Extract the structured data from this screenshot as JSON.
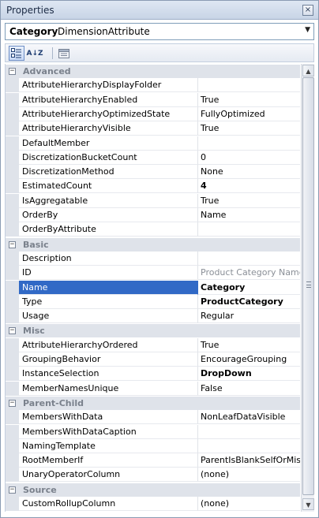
{
  "window": {
    "title": "Properties",
    "close_glyph": "×"
  },
  "object_selector": {
    "label": "Category",
    "value": "DimensionAttribute",
    "dropdown_glyph": "▼"
  },
  "toolbar": {
    "categorized_icon": "categorized-icon",
    "alphabetical_label": "A↓Z",
    "property_pages_icon": "property-pages-icon"
  },
  "grid": {
    "categories": [
      {
        "name": "Advanced",
        "toggle": "−",
        "properties": [
          {
            "name": "AttributeHierarchyDisplayFolder",
            "value": ""
          },
          {
            "name": "AttributeHierarchyEnabled",
            "value": "True"
          },
          {
            "name": "AttributeHierarchyOptimizedState",
            "value": "FullyOptimized"
          },
          {
            "name": "AttributeHierarchyVisible",
            "value": "True"
          },
          {
            "name": "DefaultMember",
            "value": ""
          },
          {
            "name": "DiscretizationBucketCount",
            "value": "0"
          },
          {
            "name": "DiscretizationMethod",
            "value": "None"
          },
          {
            "name": "EstimatedCount",
            "value": "4",
            "bold": true
          },
          {
            "name": "IsAggregatable",
            "value": "True"
          },
          {
            "name": "OrderBy",
            "value": "Name"
          },
          {
            "name": "OrderByAttribute",
            "value": ""
          }
        ]
      },
      {
        "name": "Basic",
        "toggle": "−",
        "properties": [
          {
            "name": "Description",
            "value": ""
          },
          {
            "name": "ID",
            "value": "Product Category Name",
            "dim": true
          },
          {
            "name": "Name",
            "value": "Category",
            "bold": true,
            "selected": true
          },
          {
            "name": "Type",
            "value": "ProductCategory",
            "bold": true
          },
          {
            "name": "Usage",
            "value": "Regular"
          }
        ]
      },
      {
        "name": "Misc",
        "toggle": "−",
        "properties": [
          {
            "name": "AttributeHierarchyOrdered",
            "value": "True"
          },
          {
            "name": "GroupingBehavior",
            "value": "EncourageGrouping"
          },
          {
            "name": "InstanceSelection",
            "value": "DropDown",
            "bold": true
          },
          {
            "name": "MemberNamesUnique",
            "value": "False"
          }
        ]
      },
      {
        "name": "Parent-Child",
        "toggle": "−",
        "properties": [
          {
            "name": "MembersWithData",
            "value": "NonLeafDataVisible"
          },
          {
            "name": "MembersWithDataCaption",
            "value": ""
          },
          {
            "name": "NamingTemplate",
            "value": ""
          },
          {
            "name": "RootMemberIf",
            "value": "ParentIsBlankSelfOrMissing"
          },
          {
            "name": "UnaryOperatorColumn",
            "value": "(none)"
          }
        ]
      },
      {
        "name": "Source",
        "toggle": "−",
        "properties": [
          {
            "name": "CustomRollupColumn",
            "value": "(none)"
          }
        ]
      }
    ]
  },
  "scrollbar": {
    "up_glyph": "▲",
    "down_glyph": "▼"
  },
  "colors": {
    "selection": "#3169c6",
    "category_band": "#dfe3ea",
    "border": "#8a9bb3"
  }
}
